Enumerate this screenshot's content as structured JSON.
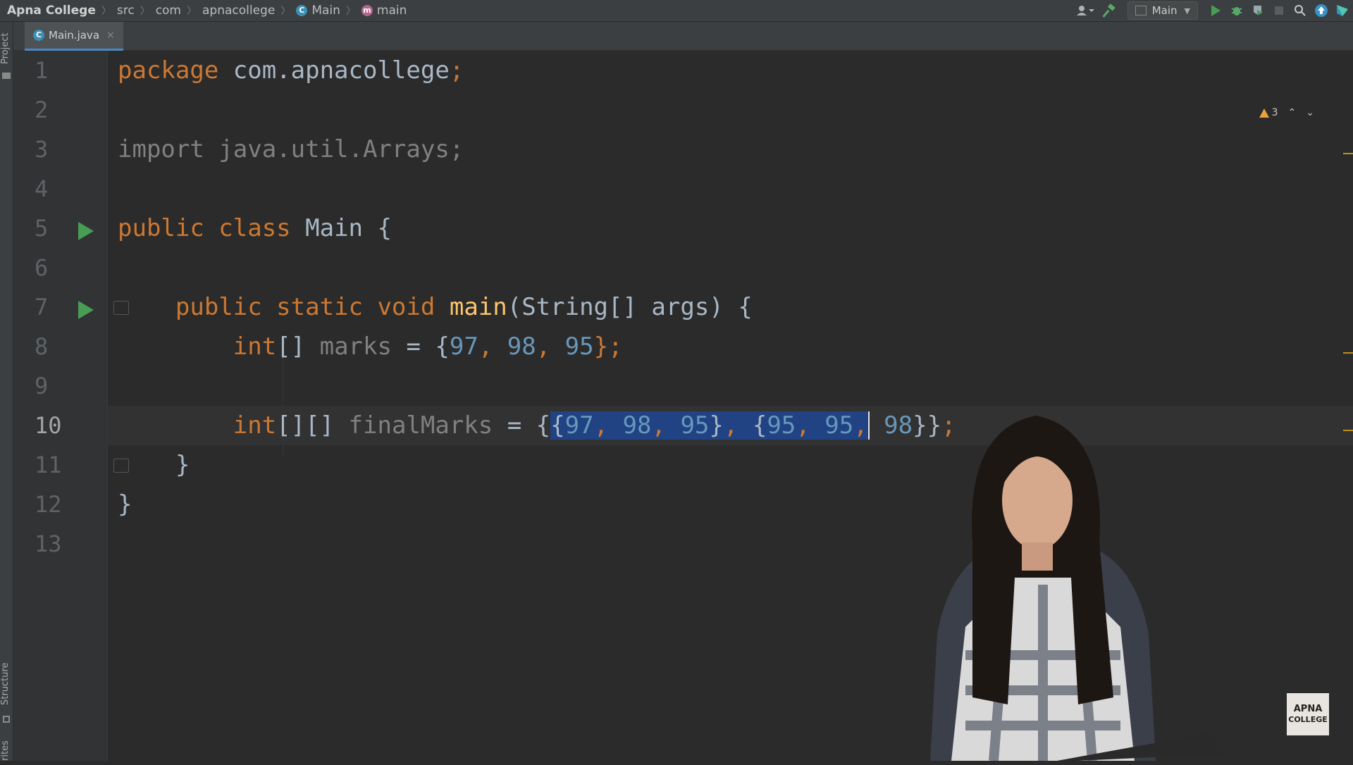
{
  "breadcrumb": {
    "project": "Apna College",
    "items": [
      "src",
      "com",
      "apnacollege",
      "Main",
      "main"
    ]
  },
  "toolbar": {
    "run_config": "Main",
    "icons": [
      "user-icon",
      "hammer-icon",
      "run-icon",
      "debug-icon",
      "coverage-icon",
      "stop-icon",
      "search-icon",
      "update-icon",
      "plugin-icon"
    ]
  },
  "side_tabs": {
    "project": "Project",
    "structure": "Structure",
    "favorites": "rites"
  },
  "tab": {
    "filename": "Main.java",
    "close": "×"
  },
  "editor": {
    "line_numbers": [
      "1",
      "2",
      "3",
      "4",
      "5",
      "6",
      "7",
      "8",
      "9",
      "10",
      "11",
      "12",
      "13"
    ],
    "warnings": "3",
    "code": {
      "l1_kw": "package",
      "l1_rest": " com.apnacollege",
      "l1_semi": ";",
      "l3": "import java.util.Arrays;",
      "l5_kw": "public class",
      "l5_rest": " Main {",
      "l7_kw": "public static void",
      "l7_fn": "main",
      "l7_rest": "(String[] args) {",
      "l8_kw": "int",
      "l8_br": "[] ",
      "l8_var": "marks",
      "l8_eq": " = {",
      "l8_n1": "97",
      "l8_c1": ", ",
      "l8_n2": "98",
      "l8_c2": ", ",
      "l8_n3": "95",
      "l8_end": "};",
      "l10_kw": "int",
      "l10_br": "[][] ",
      "l10_var": "finalMarks",
      "l10_eq": " = {",
      "l10_sel_open": "{",
      "l10_a": "97",
      "l10_ca": ", ",
      "l10_b": "98",
      "l10_cb": ", ",
      "l10_c": "95",
      "l10_close1": "}",
      "l10_comma": ", ",
      "l10_open2": "{",
      "l10_d": "95",
      "l10_cd": ", ",
      "l10_e": "95",
      "l10_ce": ",",
      "l10_space": " ",
      "l10_f": "98",
      "l10_close2": "}}",
      "l10_semi": ";",
      "l11": "}",
      "l12": "}"
    }
  },
  "logo": {
    "line1": "APNA",
    "line2": "COLLEGE"
  }
}
